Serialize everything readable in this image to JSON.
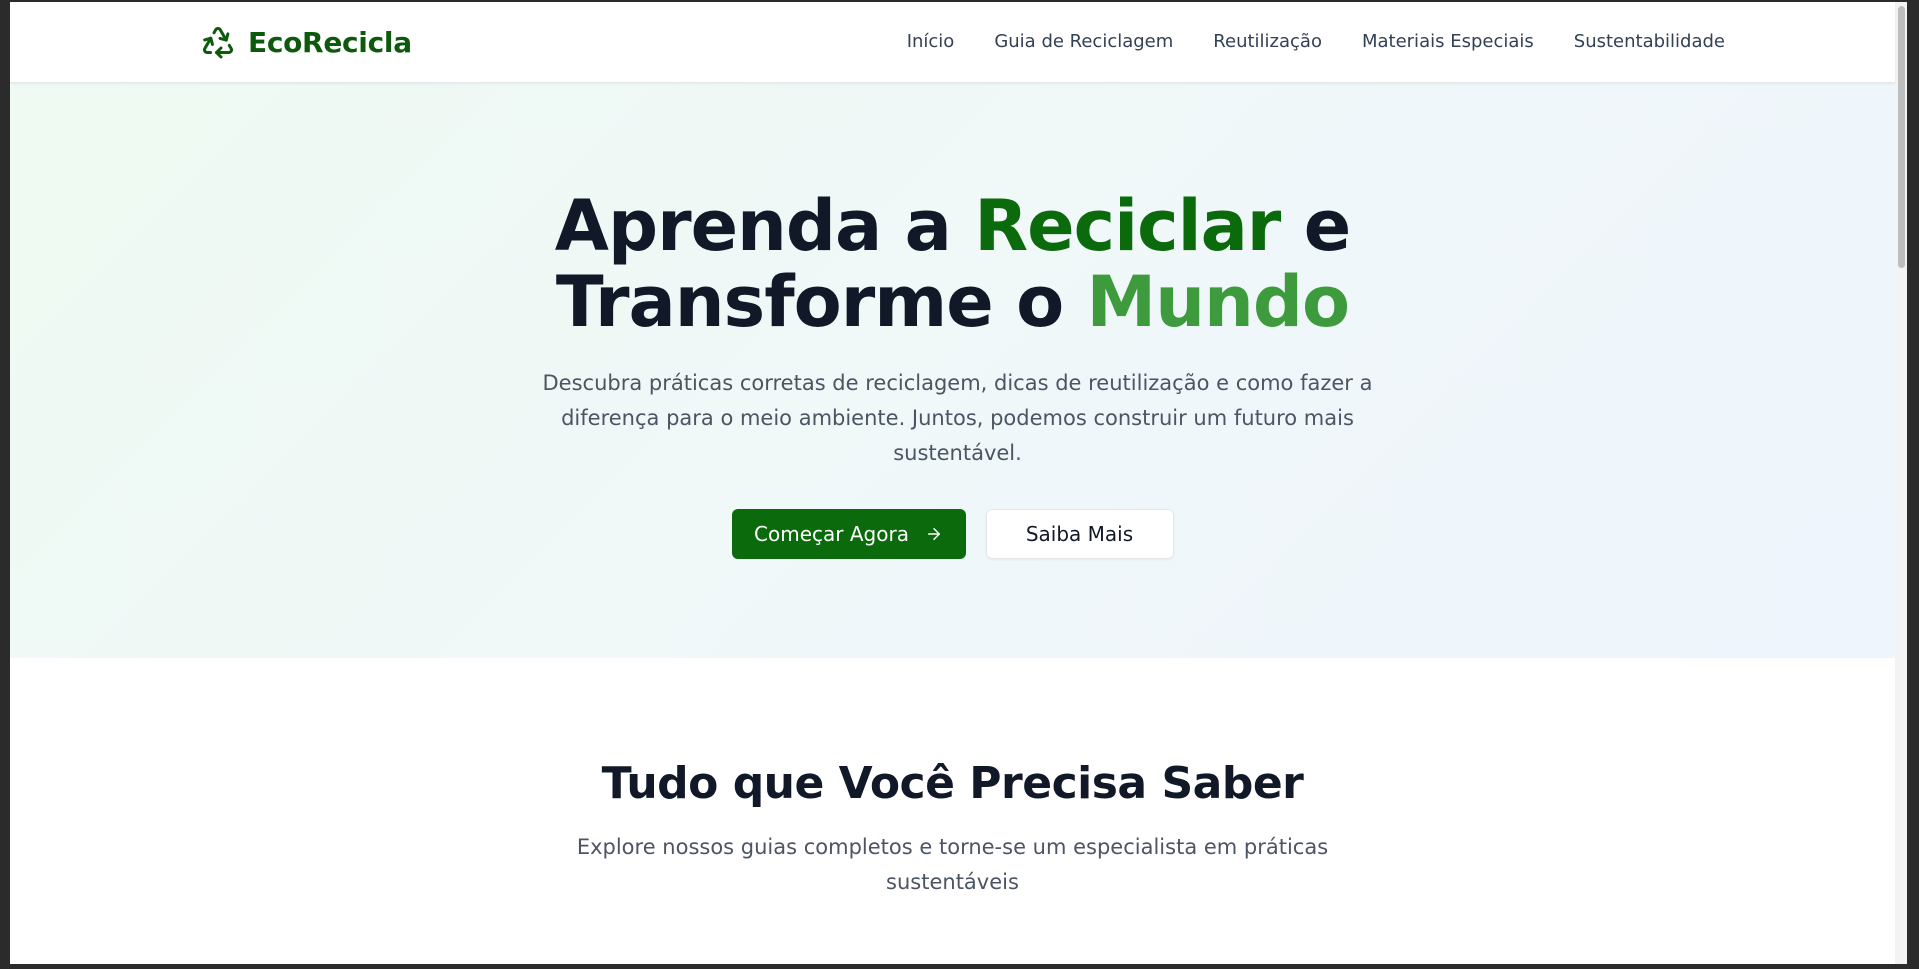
{
  "brand": {
    "name": "EcoRecicla",
    "icon": "recycle-icon",
    "color": "#0d5a0d"
  },
  "nav": {
    "links": [
      {
        "label": "Início"
      },
      {
        "label": "Guia de Reciclagem"
      },
      {
        "label": "Reutilização"
      },
      {
        "label": "Materiais Especiais"
      },
      {
        "label": "Sustentabilidade"
      }
    ]
  },
  "hero": {
    "title_part1": "Aprenda a ",
    "title_highlight1": "Reciclar",
    "title_part2": " e",
    "title_part3": "Transforme o ",
    "title_highlight2": "Mundo",
    "subtitle": "Descubra práticas corretas de reciclagem, dicas de reutilização e como fazer a diferença para o meio ambiente. Juntos, podemos construir um futuro mais sustentável.",
    "primary_button": "Começar Agora",
    "primary_button_icon": "arrow-right-icon",
    "secondary_button": "Saiba Mais"
  },
  "features": {
    "title": "Tudo que Você Precisa Saber",
    "subtitle": "Explore nossos guias completos e torne-se um especialista em práticas sustentáveis"
  },
  "colors": {
    "primary": "#0b6a0b",
    "accent": "#3d9a3d",
    "text_dark": "#111827",
    "text_muted": "#4b5563"
  }
}
